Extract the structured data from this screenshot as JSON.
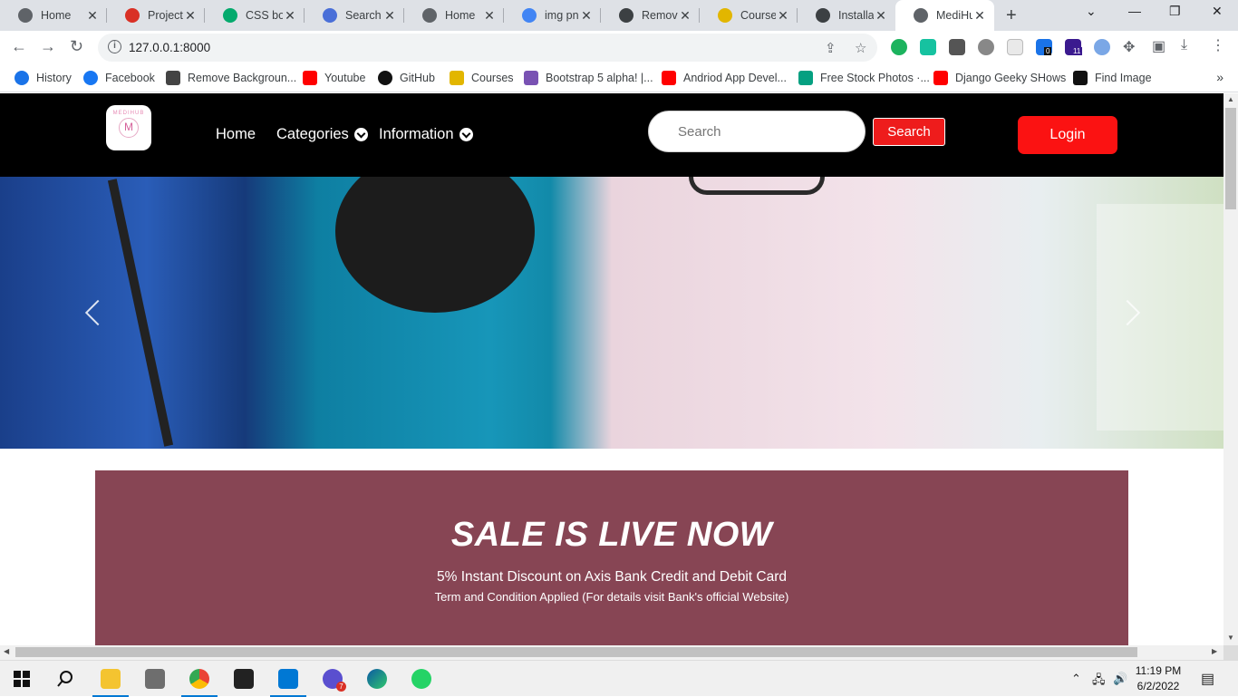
{
  "browser": {
    "tabs": [
      {
        "title": "Home",
        "icon": "globe-icon",
        "color": "#5f6368"
      },
      {
        "title": "Projects",
        "icon": "projects-icon",
        "color": "#d93025"
      },
      {
        "title": "CSS box",
        "icon": "w3schools-icon",
        "color": "#04aa6d"
      },
      {
        "title": "Search v",
        "icon": "flag-icon",
        "color": "#4a6fd8"
      },
      {
        "title": "Home",
        "icon": "globe-icon",
        "color": "#5f6368"
      },
      {
        "title": "img png",
        "icon": "google-icon",
        "color": "#4285f4"
      },
      {
        "title": "Remove",
        "icon": "layers-icon",
        "color": "#3c4043"
      },
      {
        "title": "Courses",
        "icon": "courses-icon",
        "color": "#e2b600"
      },
      {
        "title": "Installati",
        "icon": "docs-icon",
        "color": "#3c4043"
      },
      {
        "title": "MediHu",
        "icon": "globe-icon",
        "color": "#5f6368",
        "active": true
      }
    ],
    "address": "127.0.0.1:8000",
    "bookmarks": [
      {
        "label": "History",
        "icon": "history-icon",
        "color": "#1a73e8"
      },
      {
        "label": "Facebook",
        "icon": "facebook-icon",
        "color": "#1877f2"
      },
      {
        "label": "Remove Backgroun...",
        "icon": "layers-icon",
        "color": "#444"
      },
      {
        "label": "Youtube",
        "icon": "youtube-icon",
        "color": "#ff0000"
      },
      {
        "label": "GitHub",
        "icon": "github-icon",
        "color": "#111"
      },
      {
        "label": "Courses",
        "icon": "courses-icon",
        "color": "#e2b600"
      },
      {
        "label": "Bootstrap 5 alpha! |...",
        "icon": "bootstrap-icon",
        "color": "#7952b3"
      },
      {
        "label": "Andriod App Devel...",
        "icon": "youtube-icon",
        "color": "#ff0000"
      },
      {
        "label": "Free Stock Photos ·...",
        "icon": "stock-photos-icon",
        "color": "#05a081"
      },
      {
        "label": "Django Geeky SHows",
        "icon": "youtube-icon",
        "color": "#ff0000"
      },
      {
        "label": "Find Image",
        "icon": "find-image-icon",
        "color": "#111"
      }
    ],
    "extension_badges": [
      "0",
      "11"
    ]
  },
  "site": {
    "logo_text": "MEDIHUB",
    "logo_mark": "M",
    "nav": {
      "home": "Home",
      "categories": "Categories",
      "information": "Information"
    },
    "search_placeholder": "Search",
    "search_button": "Search",
    "login_button": "Login",
    "sale": {
      "title": "SALE IS LIVE NOW",
      "line1": "5% Instant Discount on Axis Bank Credit and Debit Card",
      "line2": "Term and Condition Applied (For details visit Bank's official Website)"
    },
    "colors": {
      "nav_bg": "#000000",
      "accent_red": "#fb1212",
      "sale_bg": "#874554"
    }
  },
  "taskbar": {
    "badge_count": "7",
    "time": "11:19 PM",
    "date": "6/2/2022"
  }
}
